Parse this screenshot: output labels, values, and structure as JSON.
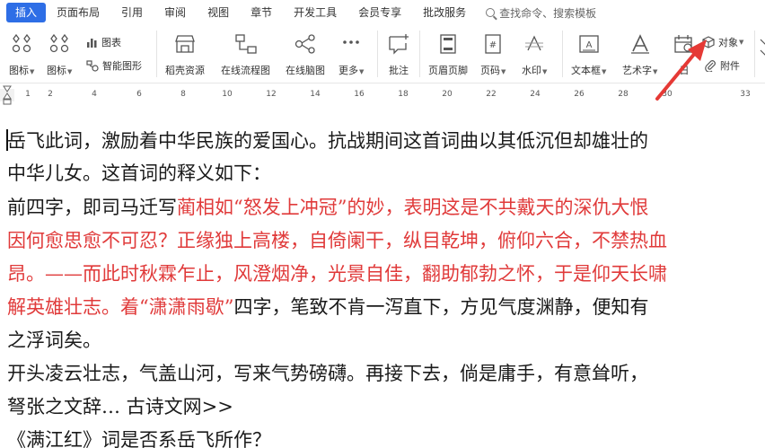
{
  "tabs": [
    {
      "label": "插入",
      "active": true
    },
    {
      "label": "页面布局"
    },
    {
      "label": "引用"
    },
    {
      "label": "审阅"
    },
    {
      "label": "视图"
    },
    {
      "label": "章节"
    },
    {
      "label": "开发工具"
    },
    {
      "label": "会员专享"
    },
    {
      "label": "批改服务"
    }
  ],
  "search": {
    "placeholder": "查找命令、搜索模板"
  },
  "ribbon": {
    "icon1": "图标",
    "icon2": "图标",
    "chart": "图表",
    "smart_shape": "智能图形",
    "stock_resource": "稻壳资源",
    "online_flowchart": "在线流程图",
    "online_mindmap": "在线脑图",
    "more": "更多",
    "comment": "批注",
    "header_footer": "页眉页脚",
    "page_number": "页码",
    "watermark": "水印",
    "textbox": "文本框",
    "wordart": "艺术字",
    "date": "日",
    "object": "对象",
    "attachment": "附件"
  },
  "ruler": {
    "numbers": [
      "1",
      "2",
      "4",
      "6",
      "8",
      "10",
      "12",
      "14",
      "16",
      "18",
      "20",
      "22",
      "24",
      "26",
      "28",
      "30",
      "33"
    ]
  },
  "document": {
    "line1": "岳飞此词，激励着中华民族的爱国心。抗战期间这首词曲以其低沉但却雄壮的",
    "line2": "中华儿女。这首词的释义如下：",
    "line3_a": "前四字，即司马迁写",
    "line3_b": "蔺相如“怒发上冲冠”的妙，表明这是不共戴天的深仇大恨",
    "line4": "因何愈思愈不可忍？正缘独上高楼，自倚阑干，纵目乾坤，俯仰六合，不禁热血",
    "line5": "昂。——而此时秋霖乍止，风澄烟净，光景自佳，翻助郁勃之怀，于是仰天长啸",
    "line6_a": "解英雄壮志。着“潇潇雨歇”",
    "line6_b": "四字，笔致不肯一泻直下，方见气度渊静，便知有",
    "line7": "之浮词矣。",
    "line8": "开头凌云壮志，气盖山河，写来气势磅礴。再接下去，倘是庸手，有意耸听，",
    "line9": "弩张之文辞… 古诗文网>>",
    "line10": "《满江红》词是否系岳飞所作？"
  },
  "colors": {
    "accent": "#2e6ee6",
    "red_text": "#e03a3a",
    "annotation_arrow": "#e53935"
  }
}
